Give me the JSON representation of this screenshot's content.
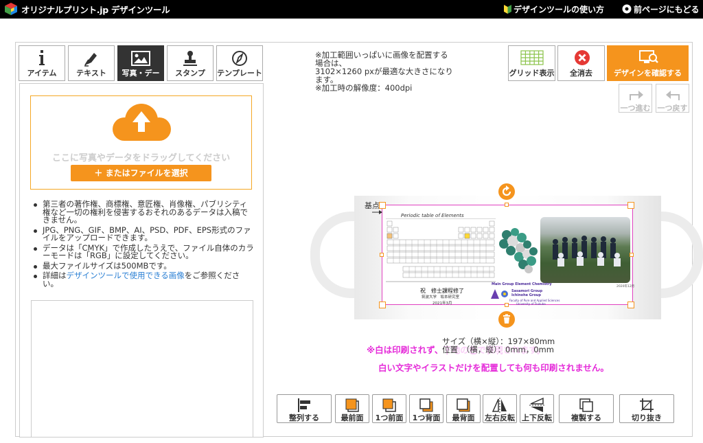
{
  "header": {
    "title": "オリジナルプリント.jp デザインツール",
    "guide_link": "デザインツールの使い方",
    "back_link": "前ページにもどる"
  },
  "tabs": [
    {
      "label": "アイテム",
      "icon": "info-icon"
    },
    {
      "label": "テキスト",
      "icon": "pen-icon"
    },
    {
      "label": "写真・デー",
      "icon": "image-icon",
      "active": true
    },
    {
      "label": "スタンプ",
      "icon": "stamp-icon"
    },
    {
      "label": "テンプレート",
      "icon": "compass-icon"
    }
  ],
  "upload": {
    "drop_text": "ここに写真やデータをドラッグしてください",
    "select_button": "＋ またはファイルを選択"
  },
  "notes": {
    "n1": "第三者の著作権、商標権、意匠権、肖像権、パブリシティ権など一切の権利を侵害するおそれのあるデータは入稿できません。",
    "n2": "JPG、PNG、GIF、BMP、AI、PSD、PDF、EPS形式のファイルをアップロードできます。",
    "n3": "データは「CMYK」で作成したうえで、ファイル自体のカラーモードは「RGB」に設定してください。",
    "n4": "最大ファイルサイズは500MBです。",
    "n5_prefix": "詳細は",
    "n5_link": "デザインツールで使用できる画像",
    "n5_suffix": "をご参照ください。"
  },
  "print_info": {
    "line1": "※加工範囲いっぱいに画像を配置する",
    "line2": "場合は、",
    "line3": "3102×1260 pxが最適な大きさになり",
    "line4": "ます。",
    "line5": "※加工時の解像度：400dpi"
  },
  "top_buttons": {
    "grid": "グリッド表示",
    "clear": "全消去",
    "confirm": "デザインを確認する",
    "redo": "一つ進む",
    "undo": "一つ戻す"
  },
  "canvas": {
    "origin_label": "基点",
    "table_title": "Periodic table of Elements",
    "diploma_line1": "祝　修士課程修了",
    "diploma_line2": "筑波大学　坂本研究室",
    "diploma_line3": "2021年3月",
    "chem_title": "Main Group Element Chemistry",
    "chem_group1": "Sasamori Group",
    "chem_group2": "Ichinohe Group",
    "chem_faculty": "Faculty of Pure and Applied Sciences",
    "chem_univ": "University of Tsukuba",
    "photo_date": "2020年12月",
    "size_label": "サイズ（横×縦）：197×80mm",
    "pos_label": "位置　（横，縦）：0mm，0mm"
  },
  "warnings": {
    "line1": "※白は印刷されず、下地の色で表現されます。",
    "line2": "白い文字やイラストだけを配置しても何も印刷されません。"
  },
  "toolbar": [
    {
      "label": "整列する",
      "icon": "align-icon"
    },
    {
      "label": "最前面",
      "icon": "bring-front-icon"
    },
    {
      "label": "1つ前面",
      "icon": "bring-forward-icon"
    },
    {
      "label": "1つ背面",
      "icon": "send-backward-icon"
    },
    {
      "label": "最背面",
      "icon": "send-back-icon"
    },
    {
      "label": "左右反転",
      "icon": "flip-horizontal-icon"
    },
    {
      "label": "上下反転",
      "icon": "flip-vertical-icon"
    },
    {
      "label": "複製する",
      "icon": "duplicate-icon"
    },
    {
      "label": "切り抜き",
      "icon": "crop-icon"
    }
  ],
  "colors": {
    "accent": "#f5941d",
    "warning": "#e52bd9",
    "link": "#2a7fd4"
  }
}
